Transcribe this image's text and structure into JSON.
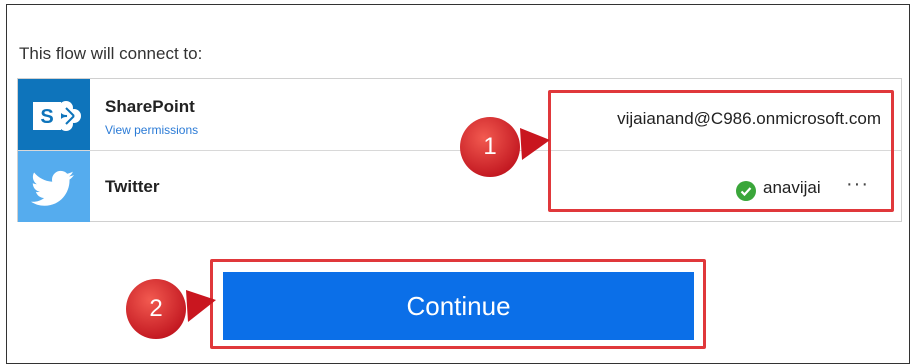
{
  "intro_text": "This flow will connect to:",
  "connections": [
    {
      "name": "SharePoint",
      "link": "View permissions",
      "account": "vijaianand@C986.onmicrosoft.com",
      "icon": "sharepoint-icon",
      "color": "#0e74bb"
    },
    {
      "name": "Twitter",
      "account": "anavijai",
      "more": "···",
      "icon": "twitter-icon",
      "color": "#55acee"
    }
  ],
  "continue_label": "Continue",
  "callouts": [
    "1",
    "2"
  ],
  "colors": {
    "accent": "#0b6fe8",
    "highlight": "#e0383b",
    "status_ok": "#3aa63a"
  }
}
